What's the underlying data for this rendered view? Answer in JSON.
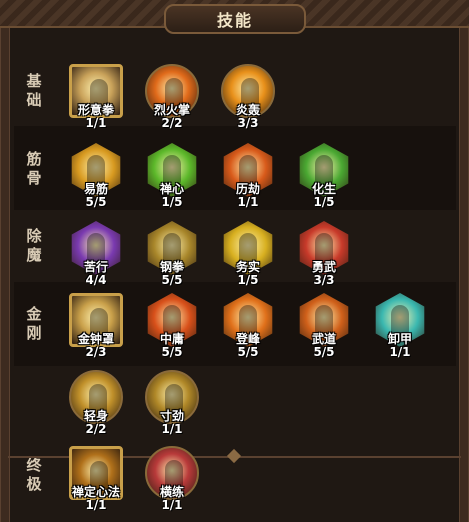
{
  "title": "技能",
  "categories": {
    "basic": "基础",
    "sinew": "筋骨",
    "demon": "除魔",
    "vajra": "金刚",
    "ultimate": "终极"
  },
  "skills": {
    "basic": [
      {
        "name": "形意拳",
        "count": "1/1",
        "color": "#c9a25a"
      },
      {
        "name": "烈火掌",
        "count": "2/2",
        "color": "#e06a1a"
      },
      {
        "name": "炎轰",
        "count": "3/3",
        "color": "#e8901a"
      }
    ],
    "sinew": [
      {
        "name": "易筋",
        "count": "5/5",
        "color": "#d89a20"
      },
      {
        "name": "禅心",
        "count": "1/5",
        "color": "#5cb82a"
      },
      {
        "name": "历劫",
        "count": "1/1",
        "color": "#d85a1a"
      },
      {
        "name": "化生",
        "count": "1/5",
        "color": "#4aa832"
      }
    ],
    "demon": [
      {
        "name": "苦行",
        "count": "4/4",
        "color": "#7a3ab0"
      },
      {
        "name": "钢拳",
        "count": "5/5",
        "color": "#a8862a"
      },
      {
        "name": "务实",
        "count": "1/5",
        "color": "#d8b020"
      },
      {
        "name": "勇武",
        "count": "3/3",
        "color": "#c83a2a"
      }
    ],
    "vajra": [
      {
        "name": "金钟罩",
        "count": "2/3",
        "color": "#c9a04a"
      },
      {
        "name": "中庸",
        "count": "5/5",
        "color": "#d8501a"
      },
      {
        "name": "登峰",
        "count": "5/5",
        "color": "#e0701a"
      },
      {
        "name": "武道",
        "count": "5/5",
        "color": "#d0601a"
      },
      {
        "name": "卸甲",
        "count": "1/1",
        "color": "#3ab8b0"
      },
      {
        "name": "轻身",
        "count": "2/2",
        "color": "#c0902a"
      },
      {
        "name": "寸劲",
        "count": "1/1",
        "color": "#b08828"
      }
    ],
    "ultimate": [
      {
        "name": "禅定心法",
        "count": "1/1",
        "color": "#b0701a"
      },
      {
        "name": "横练",
        "count": "1/1",
        "color": "#b83a3a"
      }
    ]
  }
}
